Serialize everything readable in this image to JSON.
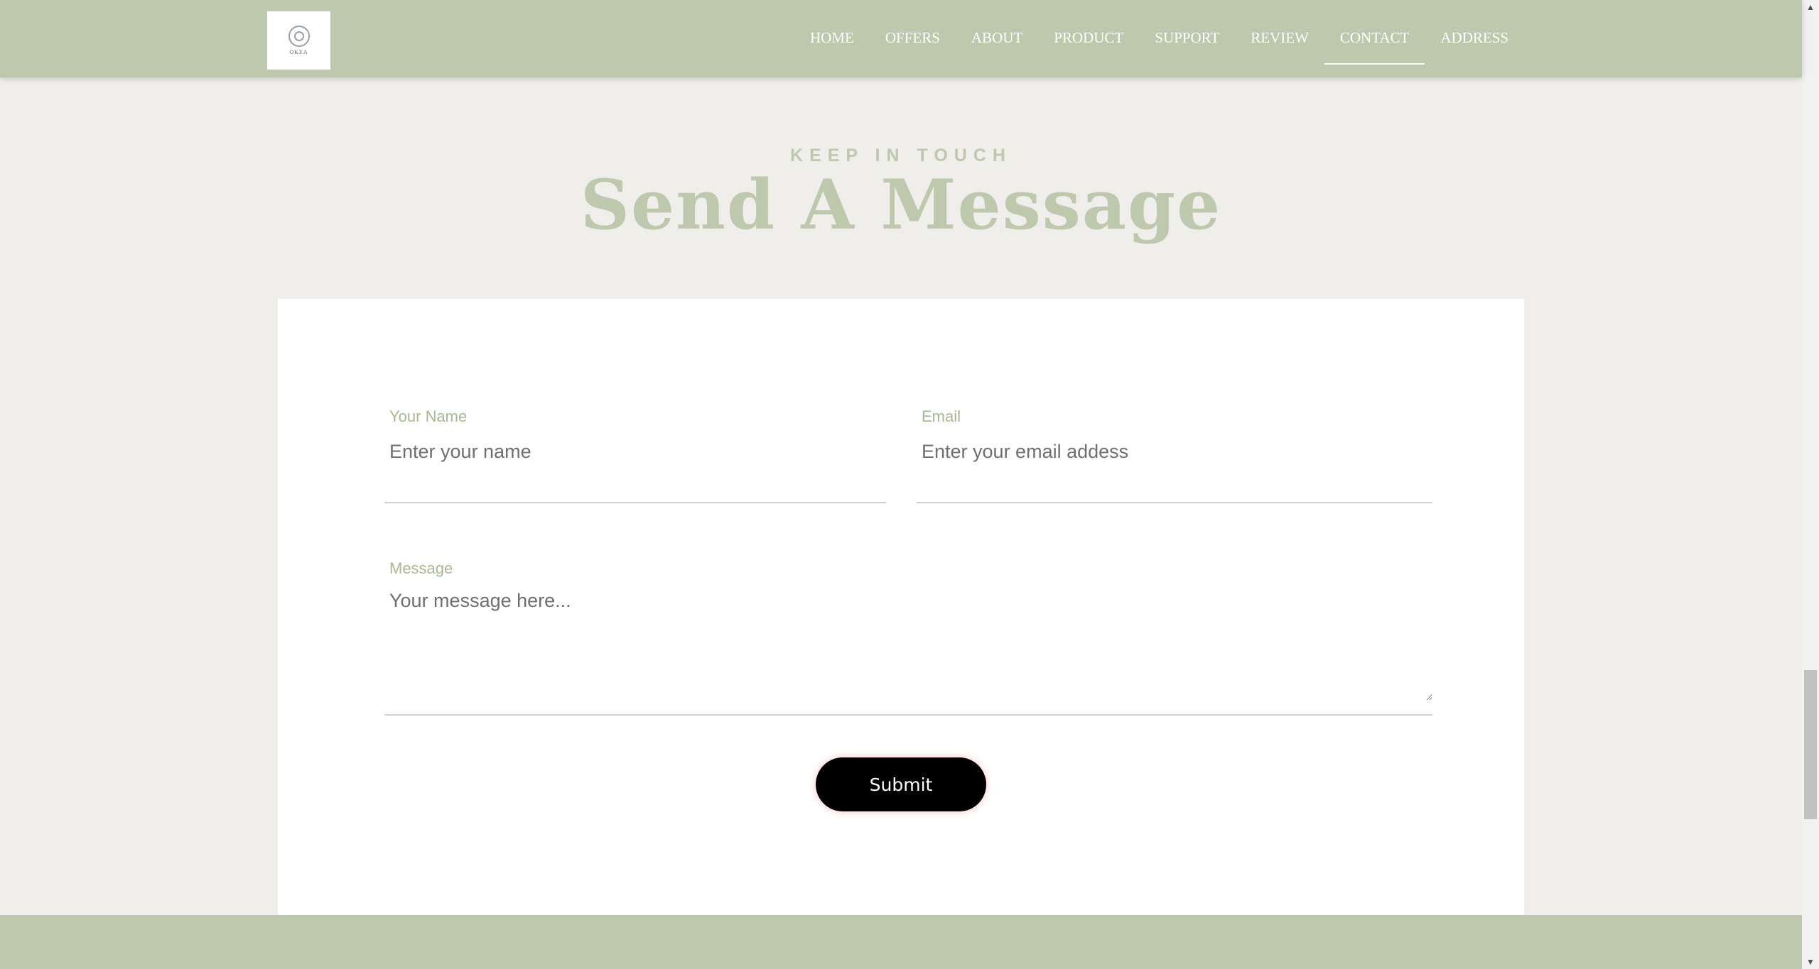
{
  "logo": {
    "text": "OKEA"
  },
  "nav": {
    "items": [
      {
        "label": "HOME"
      },
      {
        "label": "OFFERS"
      },
      {
        "label": "ABOUT"
      },
      {
        "label": "PRODUCT"
      },
      {
        "label": "SUPPORT"
      },
      {
        "label": "REVIEW"
      },
      {
        "label": "CONTACT"
      },
      {
        "label": "ADDRESS"
      }
    ],
    "active": "CONTACT"
  },
  "section": {
    "kicker": "KEEP IN TOUCH",
    "title": "Send A Message"
  },
  "form": {
    "name_label": "Your Name",
    "name_placeholder": "Enter your name",
    "email_label": "Email",
    "email_placeholder": "Enter your email addess",
    "message_label": "Message",
    "message_placeholder": "Your message here...",
    "submit_label": "Submit"
  },
  "colors": {
    "accent": "#bec8ad",
    "page_bg": "#efeeea",
    "button_bg": "#000000"
  }
}
